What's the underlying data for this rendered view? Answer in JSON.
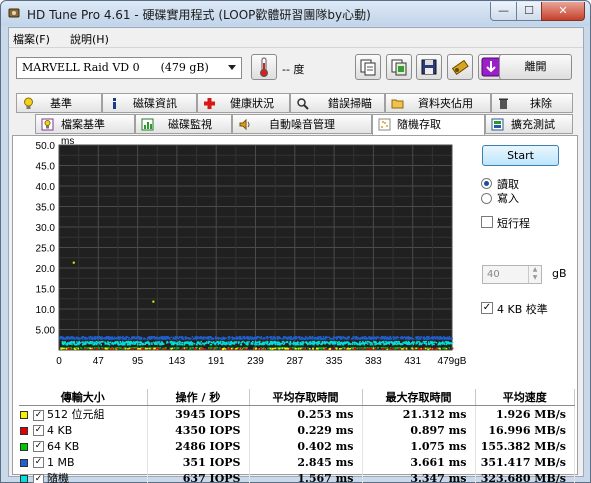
{
  "window": {
    "title": "HD Tune Pro 4.61 - 硬碟實用程式 (LOOP歡體研習團隊by心動)",
    "min": "—",
    "max": "☐",
    "close": "✕"
  },
  "menu": [
    {
      "label": "檔案(F)"
    },
    {
      "label": "說明(H)"
    }
  ],
  "toolbar": {
    "drive_name": "MARVELL Raid VD 0",
    "drive_size": "(479 gB)",
    "temperature": "-- 度",
    "exit_label": "離開",
    "icons": [
      "thermometer-icon",
      "copy-icon",
      "copy-info-icon",
      "save-icon",
      "options-icon",
      "download-icon"
    ]
  },
  "tabs_row1": [
    {
      "label": "基準",
      "icon": "bulb-icon"
    },
    {
      "label": "磁碟資訊",
      "icon": "info-icon"
    },
    {
      "label": "健康狀況",
      "icon": "health-icon"
    },
    {
      "label": "錯誤掃瞄",
      "icon": "scan-icon"
    },
    {
      "label": "資料夾佔用",
      "icon": "folder-icon"
    },
    {
      "label": "抹除",
      "icon": "trash-icon"
    }
  ],
  "tabs_row2": [
    {
      "label": "檔案基準",
      "icon": "file-benchmark-icon"
    },
    {
      "label": "磁碟監視",
      "icon": "monitor-icon"
    },
    {
      "label": "自動噪音管理",
      "icon": "speaker-icon"
    },
    {
      "label": "隨機存取",
      "icon": "random-access-icon",
      "active": true
    },
    {
      "label": "擴充測試",
      "icon": "extra-tests-icon"
    }
  ],
  "controls": {
    "start_label": "Start",
    "read_label": "讀取",
    "write_label": "寫入",
    "read_selected": true,
    "short_stroke_label": "短行程",
    "short_stroke_checked": false,
    "short_stroke_value": "40",
    "short_stroke_unit": "gB",
    "align_4kb_label": "4 KB 校準",
    "align_4kb_checked": true
  },
  "results": {
    "headers": [
      "傳輸大小",
      "操作 / 秒",
      "平均存取時間",
      "最大存取時間",
      "平均速度"
    ],
    "rows": [
      {
        "color": "#f4f400",
        "checked": true,
        "name": "512 位元組",
        "ops": "3945 IOPS",
        "avg": "0.253 ms",
        "max": "21.312 ms",
        "speed": "1.926 MB/s"
      },
      {
        "color": "#e00000",
        "checked": true,
        "name": "4 KB",
        "ops": "4350 IOPS",
        "avg": "0.229 ms",
        "max": "0.897 ms",
        "speed": "16.996 MB/s"
      },
      {
        "color": "#00c800",
        "checked": true,
        "name": "64 KB",
        "ops": "2486 IOPS",
        "avg": "0.402 ms",
        "max": "1.075 ms",
        "speed": "155.382 MB/s"
      },
      {
        "color": "#1f5fd0",
        "checked": true,
        "name": "1 MB",
        "ops": "351 IOPS",
        "avg": "2.845 ms",
        "max": "3.661 ms",
        "speed": "351.417 MB/s"
      },
      {
        "color": "#00e0e0",
        "checked": true,
        "name": "隨機",
        "ops": "637 IOPS",
        "avg": "1.567 ms",
        "max": "3.347 ms",
        "speed": "323.680 MB/s"
      }
    ]
  },
  "chart_data": {
    "type": "scatter",
    "ylabel": "ms",
    "ylim": [
      0,
      50
    ],
    "xlim": [
      0,
      479
    ],
    "y_ticks": [
      "50.0",
      "45.0",
      "40.0",
      "35.0",
      "30.0",
      "25.0",
      "20.0",
      "15.0",
      "10.0",
      "5.00"
    ],
    "x_ticks": [
      "0",
      "47",
      "95",
      "143",
      "191",
      "239",
      "287",
      "335",
      "383",
      "431",
      "479gB"
    ],
    "grid": true,
    "background": "#202020",
    "series": [
      {
        "name": "512 位元組",
        "color": "#f4f400",
        "points": [
          [
            20,
            0.25
          ],
          [
            70,
            0.3
          ],
          [
            120,
            0.28
          ],
          [
            200,
            0.22
          ],
          [
            260,
            0.3
          ],
          [
            330,
            0.25
          ],
          [
            400,
            0.27
          ],
          [
            450,
            0.24
          ],
          [
            18,
            21.3
          ],
          [
            115,
            11.8
          ]
        ]
      },
      {
        "name": "4 KB",
        "color": "#e00000",
        "points": [
          [
            10,
            0.23
          ],
          [
            60,
            0.22
          ],
          [
            130,
            0.25
          ],
          [
            210,
            0.21
          ],
          [
            300,
            0.23
          ],
          [
            380,
            0.26
          ],
          [
            440,
            0.22
          ]
        ]
      },
      {
        "name": "64 KB",
        "color": "#00c800",
        "points": [
          [
            15,
            0.4
          ],
          [
            80,
            0.42
          ],
          [
            160,
            0.38
          ],
          [
            240,
            0.41
          ],
          [
            320,
            0.4
          ],
          [
            410,
            0.39
          ],
          [
            470,
            0.43
          ]
        ]
      },
      {
        "name": "1 MB",
        "color": "#1f5fd0",
        "points": [
          [
            5,
            2.8
          ],
          [
            50,
            2.9
          ],
          [
            100,
            2.7
          ],
          [
            150,
            3.0
          ],
          [
            200,
            2.8
          ],
          [
            250,
            2.9
          ],
          [
            300,
            2.7
          ],
          [
            350,
            2.8
          ],
          [
            400,
            2.9
          ],
          [
            450,
            2.8
          ]
        ]
      },
      {
        "name": "隨機",
        "color": "#00e0e0",
        "points": [
          [
            5,
            1.5
          ],
          [
            60,
            1.6
          ],
          [
            110,
            1.4
          ],
          [
            170,
            1.7
          ],
          [
            230,
            1.5
          ],
          [
            290,
            1.6
          ],
          [
            340,
            1.4
          ],
          [
            390,
            1.6
          ],
          [
            440,
            1.5
          ],
          [
            475,
            1.6
          ]
        ]
      }
    ]
  }
}
